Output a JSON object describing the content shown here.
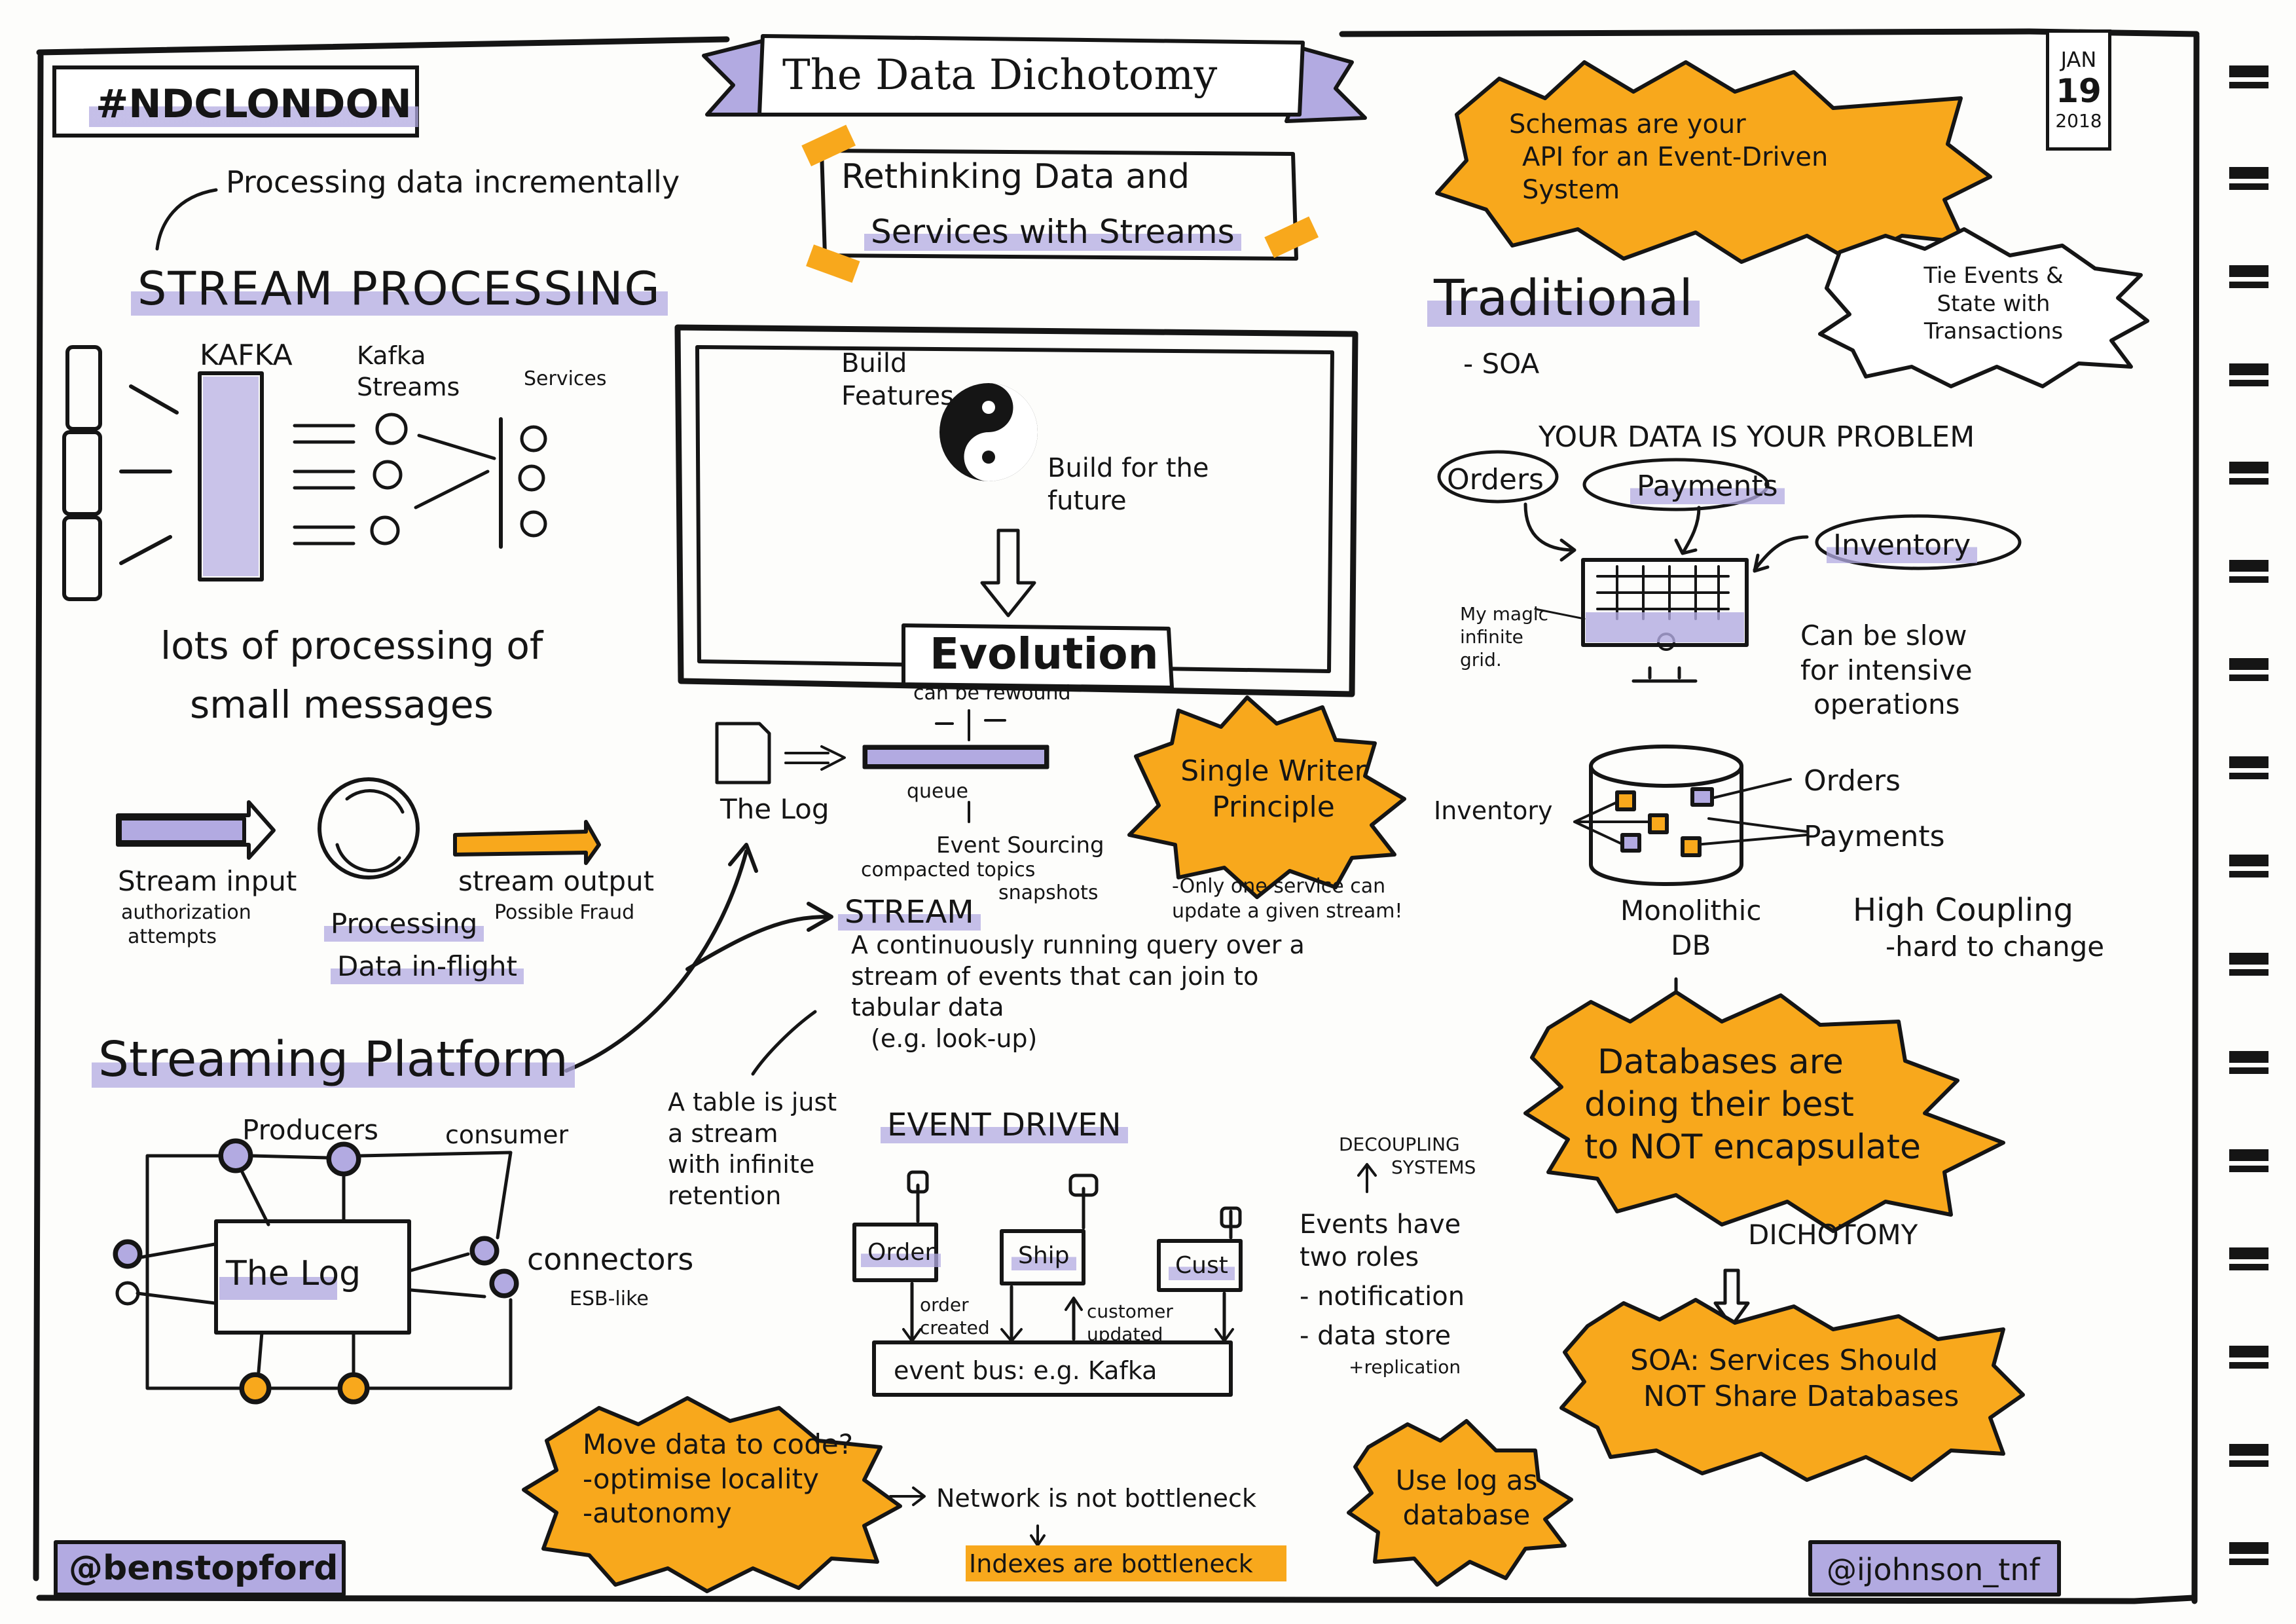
{
  "header": {
    "hashtag": "#NDCLONDON",
    "title": "The Data Dichotomy",
    "subtitle_line1": "Rethinking Data and",
    "subtitle_line2": "Services with Streams",
    "date": {
      "month": "JAN",
      "day": "19",
      "year": "2018"
    }
  },
  "schemas_burst": [
    "Schemas are your",
    "API for an Event-Driven",
    "System"
  ],
  "stream_processing": {
    "annotation": "Processing data incrementally",
    "heading": "STREAM PROCESSING",
    "kafka": "KAFKA",
    "kafka_streams": "Kafka Streams",
    "services": "Services",
    "caption_line1": "lots of processing of",
    "caption_line2": "small messages"
  },
  "flow": {
    "input_label": "Stream input",
    "input_sub_line1": "authorization",
    "input_sub_line2": "attempts",
    "processing_line1": "Processing",
    "processing_line2": "Data in-flight",
    "output_label": "stream output",
    "output_sub": "Possible Fraud"
  },
  "streaming_platform": {
    "heading": "Streaming Platform",
    "producers": "Producers",
    "consumer": "consumer",
    "log": "The Log",
    "connectors": "connectors",
    "esb": "ESB-like"
  },
  "center": {
    "build_features": "Build Features",
    "build_future": "Build for the future",
    "evolution": "Evolution",
    "rewound": "can be rewound",
    "the_log": "The Log",
    "queue": "queue",
    "event_sourcing": "Event Sourcing",
    "compacted": "compacted topics",
    "snapshots": "snapshots",
    "stream_heading": "STREAM",
    "stream_def": [
      "A continuously running query over a",
      "stream of events that can join to",
      "tabular data",
      "(e.g. look-up)"
    ],
    "table_note": [
      "A table is just",
      "a stream",
      "with infinite",
      "retention"
    ]
  },
  "single_writer": {
    "burst": [
      "Single Writer",
      "Principle"
    ],
    "note": [
      "-Only one service can",
      "update a given stream!"
    ]
  },
  "event_driven": {
    "heading": "EVENT DRIVEN",
    "services": [
      "Order",
      "Ship",
      "Cust"
    ],
    "order_created": "order created",
    "customer_updated": "customer updated",
    "bus": "event bus: e.g. Kafka"
  },
  "decoupling": {
    "label": [
      "DECOUPLING",
      "SYSTEMS"
    ],
    "roles_heading": [
      "Events have",
      "two roles"
    ],
    "roles": [
      "- notification",
      "- data store"
    ],
    "replication": "+replication"
  },
  "move_data": {
    "burst": [
      "Move data to code?",
      "-optimise locality",
      "-autonomy"
    ],
    "network": "Network is not bottleneck",
    "indexes": "Indexes are bottleneck"
  },
  "use_log": [
    "Use log as",
    "database"
  ],
  "traditional": {
    "heading": "Traditional",
    "soa": "- SOA",
    "tie_events": [
      "Tie Events &",
      "State with",
      "Transactions"
    ],
    "your_data": "YOUR DATA IS YOUR PROBLEM",
    "bubbles": [
      "Orders",
      "Payments",
      "Inventory"
    ],
    "magic_grid": [
      "My magic",
      "infinite",
      "grid."
    ],
    "slow": [
      "Can be slow",
      "for intensive",
      "operations"
    ]
  },
  "monolith": {
    "inventory": "Inventory",
    "orders": "Orders",
    "payments": "Payments",
    "db_label": [
      "Monolithic",
      "DB"
    ],
    "coupling": [
      "High Coupling",
      "-hard to change"
    ]
  },
  "databases_burst": [
    "Databases are",
    "doing their best",
    "to NOT encapsulate"
  ],
  "dichotomy": "DICHOTOMY",
  "soa_burst": [
    "SOA: Services Should",
    "NOT Share Databases"
  ],
  "footer": {
    "left_handle": "@benstopford",
    "right_handle": "@ijohnson_tnf"
  },
  "colors": {
    "orange": "#f8a81c",
    "lavender": "#b2aae1",
    "ink": "#151515"
  }
}
